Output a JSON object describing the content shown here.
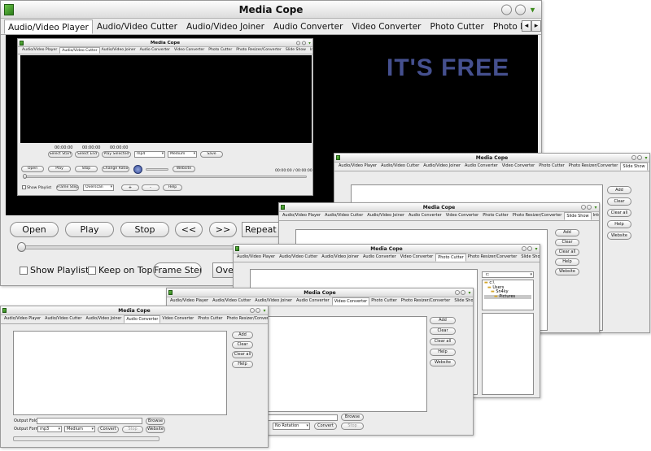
{
  "app_title": "Media Cope",
  "tabs": [
    "Audio/Video Player",
    "Audio/Video Cutter",
    "Audio/Video Joiner",
    "Audio Converter",
    "Video Converter",
    "Photo Cutter",
    "Photo Resizer/Converter",
    "Slide Show",
    "Internet Tools / Settings"
  ],
  "tab_scroll": {
    "left": "◂",
    "right": "▸"
  },
  "promo_text": "IT'S FREE",
  "colors": {
    "promo": "#45508f",
    "accent_green": "#3b8a1a"
  },
  "player": {
    "open": "Open",
    "play": "Play",
    "stop": "Stop",
    "prev": "<<",
    "next": ">>",
    "repeat": "Repeat play",
    "show_playlist": "Show Playlist",
    "keep_on_top": "Keep on Top",
    "frame_step": "Frame Step",
    "overscan": "Overscan"
  },
  "cutter": {
    "times": [
      "00:00:00",
      "00:00:00",
      "00:00:00"
    ],
    "select_start": "Select Start",
    "select_end": "Select End",
    "play_selected": "Play Selected",
    "format": "mp4",
    "quality": "Medium",
    "save": "Save",
    "open": "Open",
    "play": "Play",
    "stop": "Stop",
    "change_ratio": "Change Ratio",
    "website": "Website",
    "time_readout": "00:00:00 / 00:00:00",
    "show_playlist": "Show Playlist",
    "frame_step": "Frame Step",
    "overscan": "Overscan",
    "plus": "+",
    "minus": "-",
    "help": "Help"
  },
  "list_buttons": {
    "add": "Add",
    "clear": "Clear",
    "clear_all": "Clear all",
    "help": "Help",
    "website": "Website"
  },
  "photo_cutter": {
    "drive": "c:",
    "folders": [
      "c:\\",
      "Users",
      "Sn4ky",
      "Pictures"
    ]
  },
  "video_converter": {
    "rotation": "No Rotation",
    "convert": "Convert",
    "stop": "Stop",
    "browse": "Browse"
  },
  "audio_converter": {
    "output_folder": "Output Folder",
    "output_format": "Output Format",
    "format": "mp3",
    "quality": "Medium",
    "browse": "Browse",
    "convert": "Convert",
    "stop": "Stop",
    "website": "Website"
  }
}
